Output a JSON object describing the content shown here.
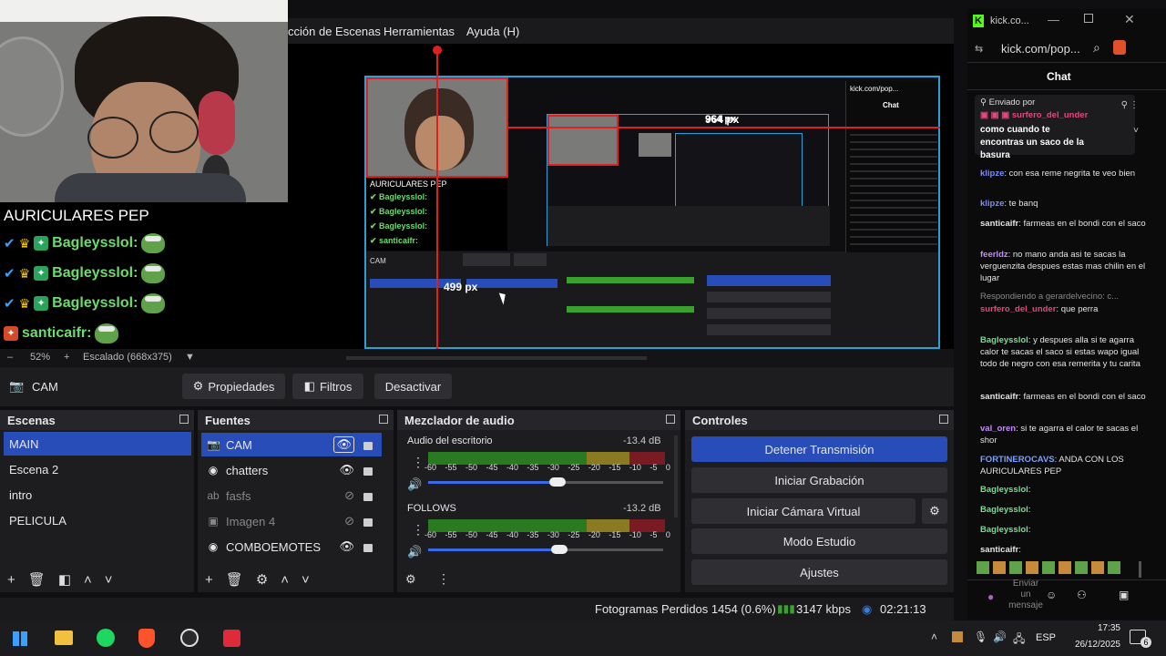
{
  "menu": {
    "escenas": "cción de Escenas",
    "herramientas": "Herramientas",
    "ayuda": "Ayuda (H)"
  },
  "overlay": {
    "title": "AURICULARES PEP",
    "lines": [
      {
        "name": "Bagleysslol:"
      },
      {
        "name": "Bagleysslol:"
      },
      {
        "name": "Bagleysslol:"
      },
      {
        "name": "santicaifr:"
      }
    ]
  },
  "preview": {
    "width_label": "964 px",
    "height_label": "499 px"
  },
  "zoom": {
    "value": "52%",
    "scaling": "Escalado (668x375)"
  },
  "source_toolbar": {
    "source": "CAM",
    "properties": "Propiedades",
    "filters": "Filtros",
    "deactivate": "Desactivar"
  },
  "scenes": {
    "title": "Escenas",
    "items": [
      "MAIN",
      "Escena 2",
      "intro",
      "PELICULA"
    ],
    "selected": 0
  },
  "sources": {
    "title": "Fuentes",
    "items": [
      {
        "label": "CAM",
        "icon": "camera-icon",
        "visible": true
      },
      {
        "label": "chatters",
        "icon": "browser-icon",
        "visible": true
      },
      {
        "label": "fasfs",
        "icon": "text-icon",
        "visible": false
      },
      {
        "label": "Imagen 4",
        "icon": "image-icon",
        "visible": false
      },
      {
        "label": "COMBOEMOTES",
        "icon": "browser-icon",
        "visible": true
      }
    ]
  },
  "audio": {
    "title": "Mezclador de audio",
    "channels": [
      {
        "name": "Audio del escritorio",
        "db": "-13.4 dB",
        "level": 0.55
      },
      {
        "name": "FOLLOWS",
        "db": "-13.2 dB",
        "level": 0.56
      }
    ],
    "scale": [
      "-60",
      "-55",
      "-50",
      "-45",
      "-40",
      "-35",
      "-30",
      "-25",
      "-20",
      "-15",
      "-10",
      "-5",
      "0"
    ]
  },
  "controls": {
    "title": "Controles",
    "stop_stream": "Detener Transmisión",
    "start_recording": "Iniciar Grabación",
    "virtual_cam": "Iniciar Cámara Virtual",
    "studio_mode": "Modo Estudio",
    "settings": "Ajustes"
  },
  "status": {
    "dropped": "Fotogramas Perdidos 1454 (0.6%)",
    "bitrate": "3147 kbps",
    "time": "02:21:13"
  },
  "browser": {
    "tab_title": "kick.co...",
    "url": "kick.com/pop...",
    "chat_title": "Chat",
    "pinned_label": "Enviado por",
    "pinned_user": "surfero_del_under",
    "pinned_text": "como cuando te encontras un saco de la basura",
    "messages": [
      {
        "user": "klipze",
        "text": ": con esa reme negrita te veo bien"
      },
      {
        "user": "klipze",
        "text": ": te banq"
      },
      {
        "user": "santicaifr",
        "text": ": farmeas en el bondi con el saco"
      },
      {
        "user": "feerldz",
        "text": ": no mano anda asi te sacas la verguenzita despues estas mas chilin en el lugar"
      },
      {
        "user": "",
        "text": "Respondiendo a gerardelvecino: c..."
      },
      {
        "user": "surfero_del_under",
        "text": ": que perra"
      },
      {
        "user": "Bagleysslol",
        "text": ": y despues alla si te agarra calor te sacas el saco si estas wapo igual todo de negro con esa remerita y tu carita"
      },
      {
        "user": "santicaifr",
        "text": ": farmeas en el bondi con el saco"
      },
      {
        "user": "val_oren",
        "text": ": si te agarra el calor te sacas el shor"
      },
      {
        "user": "FORTINEROCAVS",
        "text": ": ANDA CON LOS AURICULARES PEP"
      },
      {
        "user": "Bagleysslol",
        "text": ":"
      },
      {
        "user": "Bagleysslol",
        "text": ":"
      },
      {
        "user": "Bagleysslol",
        "text": ":"
      },
      {
        "user": "santicaifr",
        "text": ":"
      }
    ],
    "send_placeholder": "Enviar un mensaje"
  },
  "taskbar": {
    "lang": "ESP",
    "time": "17:35",
    "date": "26/12/2025",
    "notif": "6"
  }
}
